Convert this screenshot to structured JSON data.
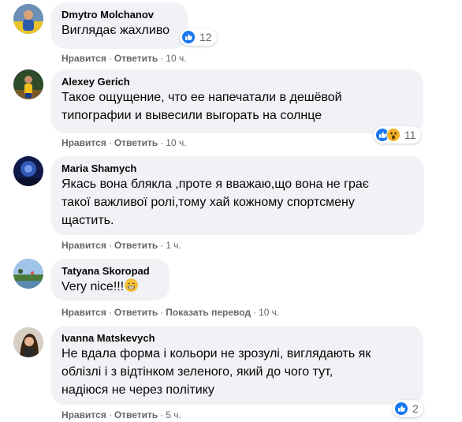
{
  "actions": {
    "like": "Нравится",
    "reply": "Ответить",
    "translate": "Показать перевод",
    "separator": "·"
  },
  "comments": [
    {
      "author": "Dmytro Molchanov",
      "text": "Виглядає жахливо",
      "time": "10 ч.",
      "reaction_count": "12",
      "reactions": [
        "like-icon"
      ]
    },
    {
      "author": "Alexey Gerich",
      "text": "Такое ощущение, что ее напечатали в дешёвой\nтипографии и вывесили выгорать на солнце",
      "time": "10 ч.",
      "reaction_count": "11",
      "reactions": [
        "like-icon",
        "wow-icon"
      ]
    },
    {
      "author": "Maria Shamych",
      "text": "Якась вона блякла ,проте я вважаю,що вона не грає\nтакої важливої ролі,тому хай кожному спортсмену\nщастить.",
      "time": "1 ч."
    },
    {
      "author": "Tatyana Skoropad",
      "text": "Very nice!!!",
      "emoji": "grinning-face-emoji",
      "time": "10 ч."
    },
    {
      "author": "Ivanna Matskevych",
      "text": "Не вдала форма і кольори не зрозулі, виглядають як\nоблізлі і з відтінком зеленого, який до чого тут,\nнадіюся не через політику",
      "time": "5 ч.",
      "reaction_count": "2",
      "reactions": [
        "like-icon"
      ]
    }
  ],
  "colors": {
    "bubble": "#f0f2f5",
    "text": "#050505",
    "secondary": "#65676b",
    "like_blue": "#1877f2",
    "wow_yellow": "#f7b125"
  }
}
